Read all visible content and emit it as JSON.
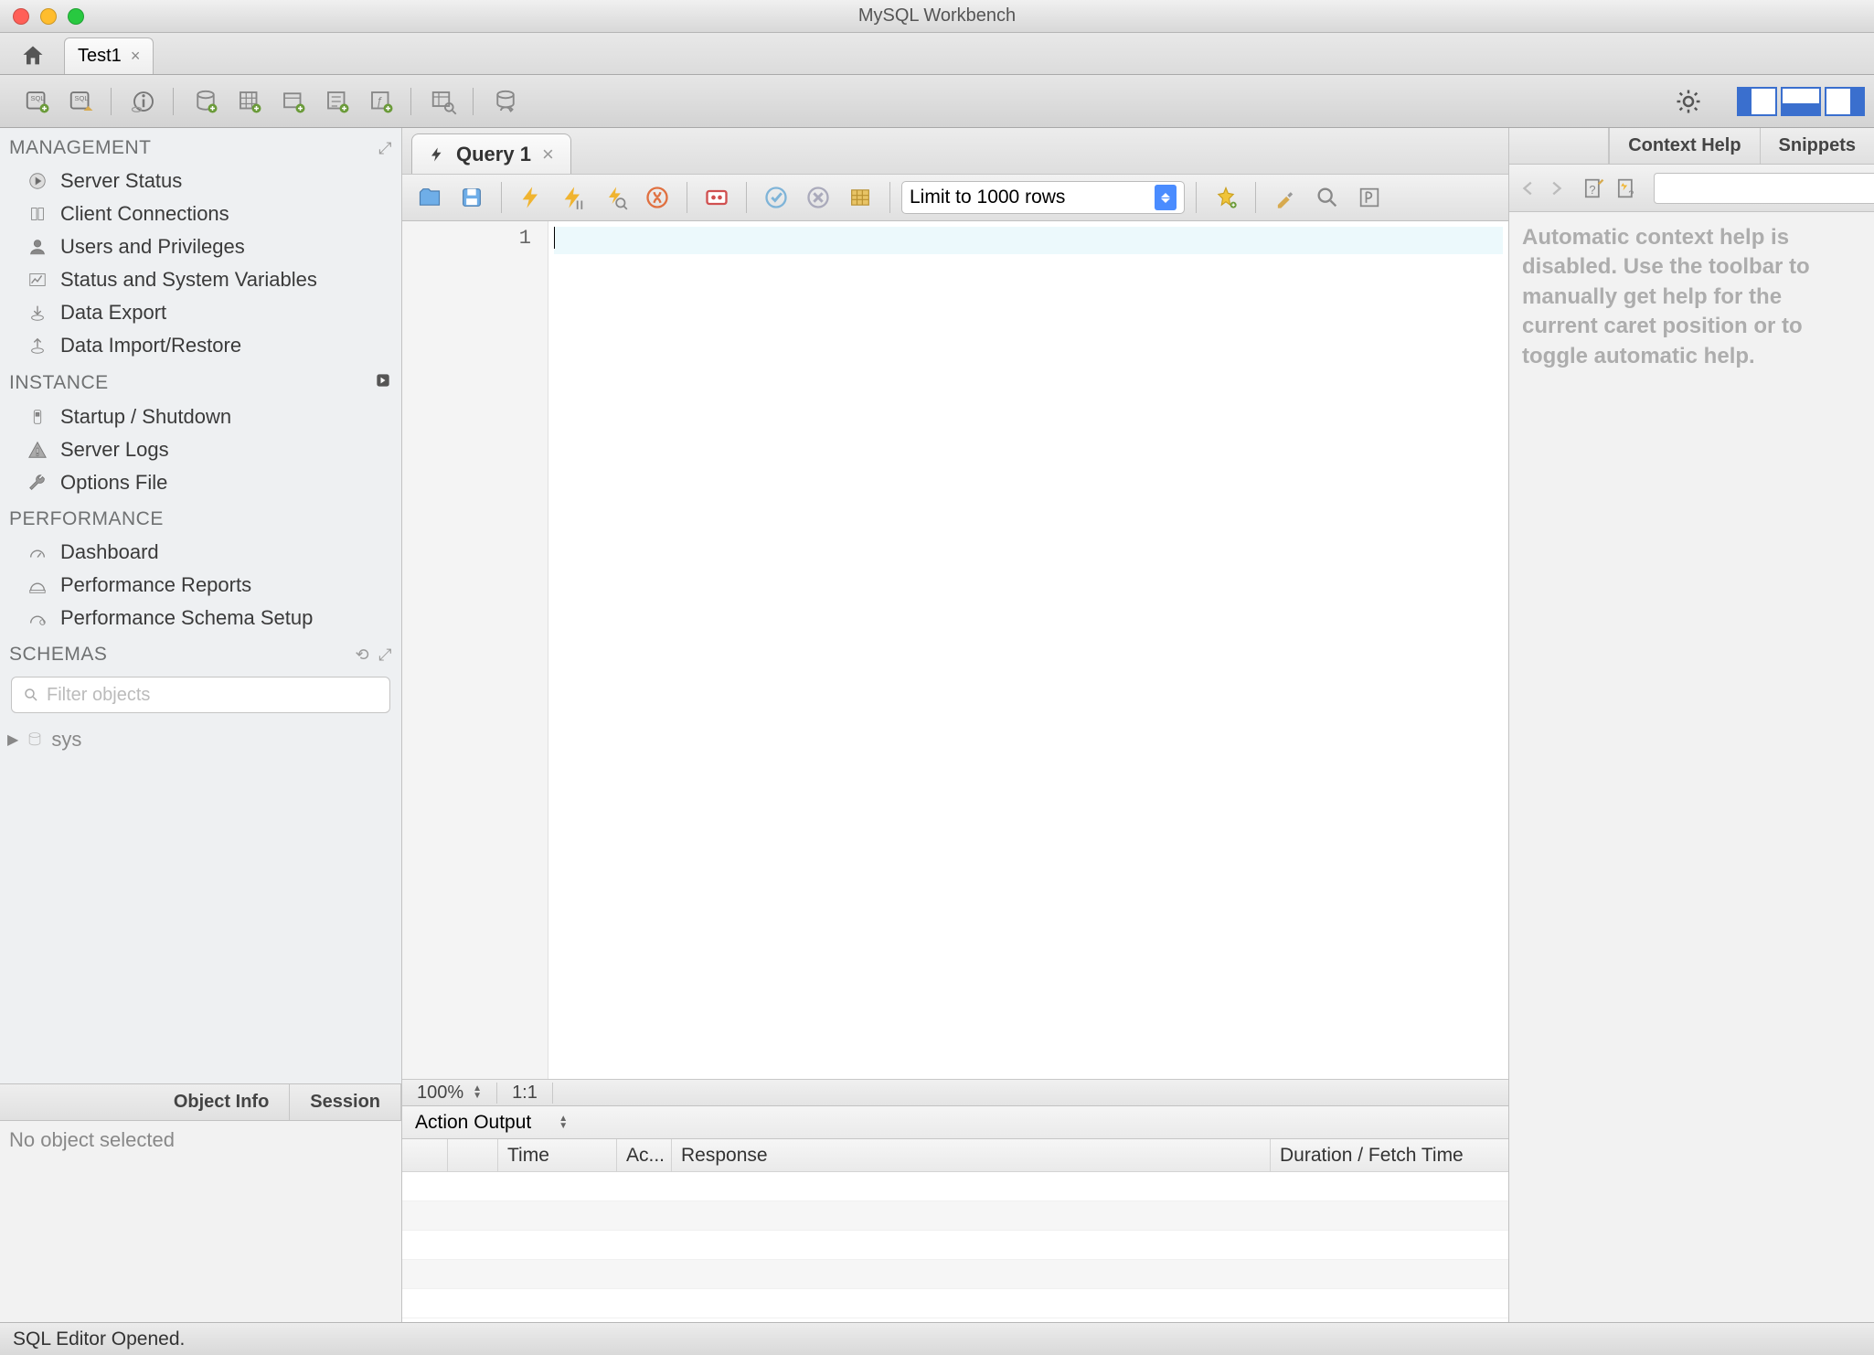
{
  "window": {
    "title": "MySQL Workbench"
  },
  "conn_tabs": {
    "active": "Test1"
  },
  "sidebar": {
    "management_head": "MANAGEMENT",
    "management": [
      "Server Status",
      "Client Connections",
      "Users and Privileges",
      "Status and System Variables",
      "Data Export",
      "Data Import/Restore"
    ],
    "instance_head": "INSTANCE",
    "instance": [
      "Startup / Shutdown",
      "Server Logs",
      "Options File"
    ],
    "performance_head": "PERFORMANCE",
    "performance": [
      "Dashboard",
      "Performance Reports",
      "Performance Schema Setup"
    ],
    "schemas_head": "SCHEMAS",
    "filter_placeholder": "Filter objects",
    "schema_items": [
      "sys"
    ],
    "lower_tabs": {
      "object_info": "Object Info",
      "session": "Session"
    },
    "lower_text": "No object selected"
  },
  "center": {
    "tab_label": "Query 1",
    "limit_label": "Limit to 1000 rows",
    "gutter": "1",
    "zoom": "100%",
    "pos": "1:1",
    "output_label": "Action Output",
    "columns": {
      "time": "Time",
      "action": "Ac...",
      "response": "Response",
      "duration": "Duration / Fetch Time"
    }
  },
  "right": {
    "tabs": {
      "context": "Context Help",
      "snippets": "Snippets"
    },
    "help_text": "Automatic context help is disabled. Use the toolbar to manually get help for the current caret position or to toggle automatic help."
  },
  "statusbar": {
    "text": "SQL Editor Opened."
  }
}
